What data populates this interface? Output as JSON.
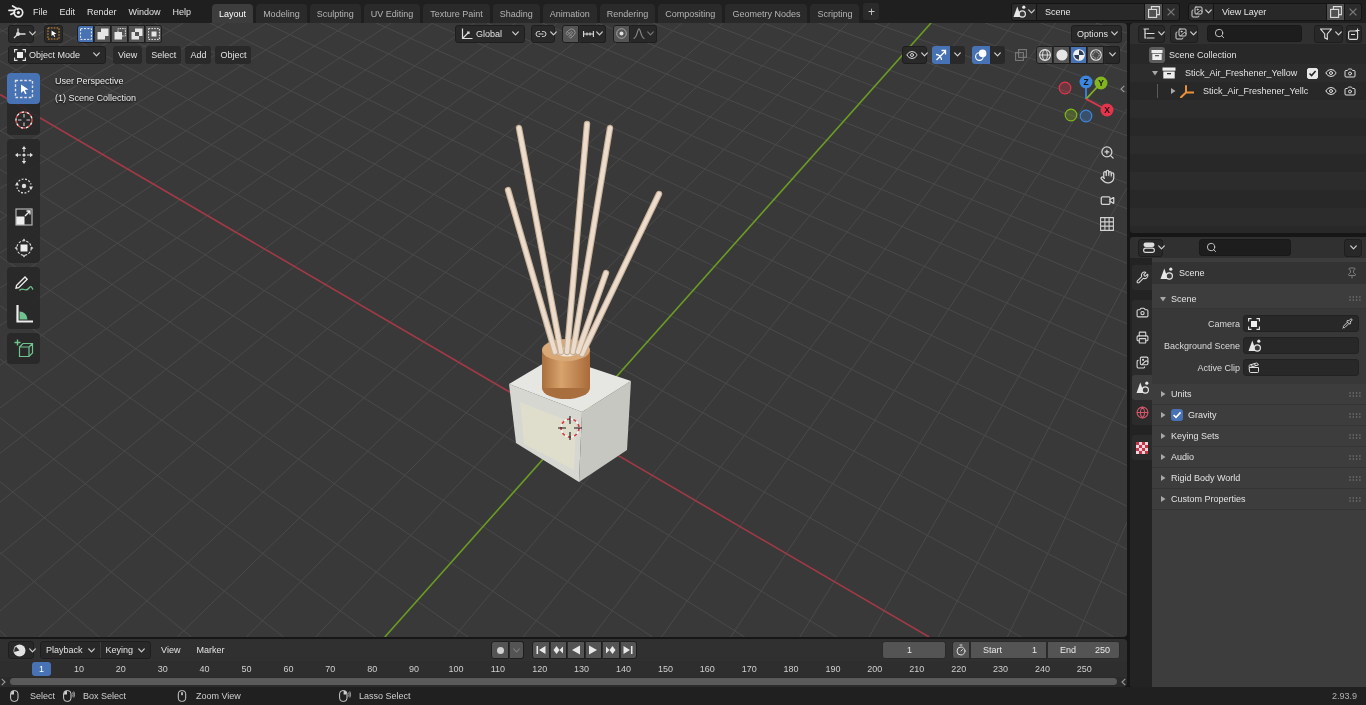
{
  "top_bar": {
    "menus": [
      "File",
      "Edit",
      "Render",
      "Window",
      "Help"
    ],
    "workspaces": [
      {
        "label": "Layout",
        "selected": true
      },
      {
        "label": "Modeling",
        "selected": false
      },
      {
        "label": "Sculpting",
        "selected": false
      },
      {
        "label": "UV Editing",
        "selected": false
      },
      {
        "label": "Texture Paint",
        "selected": false
      },
      {
        "label": "Shading",
        "selected": false
      },
      {
        "label": "Animation",
        "selected": false
      },
      {
        "label": "Rendering",
        "selected": false
      },
      {
        "label": "Compositing",
        "selected": false
      },
      {
        "label": "Geometry Nodes",
        "selected": false
      },
      {
        "label": "Scripting",
        "selected": false
      }
    ],
    "add_workspace": "+",
    "scene": "Scene",
    "view_layer": "View Layer"
  },
  "tool_settings": {
    "select_modes": [
      {
        "kind": "set",
        "selected": true
      },
      {
        "kind": "extend",
        "selected": false
      },
      {
        "kind": "subtract",
        "selected": false
      },
      {
        "kind": "difference",
        "selected": false
      },
      {
        "kind": "intersect",
        "selected": false
      }
    ],
    "orientation": "Global",
    "options": "Options"
  },
  "viewport_header": {
    "mode": "Object Mode",
    "menus": [
      "View",
      "Select",
      "Add",
      "Object"
    ],
    "toggles": [
      {
        "kind": "gizmos",
        "on": true
      },
      {
        "kind": "overlays",
        "on": true
      },
      {
        "kind": "xray",
        "on": false
      }
    ],
    "shading_modes": [
      {
        "kind": "wireframe",
        "selected": false
      },
      {
        "kind": "solid",
        "selected": false
      },
      {
        "kind": "material",
        "selected": true
      },
      {
        "kind": "rendered",
        "selected": false
      }
    ]
  },
  "toolbar": {
    "tool_groups": [
      [
        {
          "kind": "select_box",
          "selected": true
        },
        {
          "kind": "cursor",
          "selected": false
        }
      ],
      [
        {
          "kind": "move",
          "selected": false
        },
        {
          "kind": "rotate",
          "selected": false
        },
        {
          "kind": "scale",
          "selected": false
        },
        {
          "kind": "transform",
          "selected": false
        }
      ],
      [
        {
          "kind": "annotate",
          "selected": false
        },
        {
          "kind": "measure",
          "selected": false
        }
      ],
      [
        {
          "kind": "add_cube",
          "selected": false
        }
      ]
    ]
  },
  "viewport": {
    "view_name": "User Perspective",
    "collection": "(1) Scene Collection",
    "gizmo_axes": [
      {
        "label": "X",
        "color": "#e5354c"
      },
      {
        "label": "Y",
        "color": "#82b51f"
      },
      {
        "label": "Z",
        "color": "#3b86de"
      }
    ]
  },
  "timeline": {
    "menus": [
      {
        "label": "Playback",
        "kind": "dropdown"
      },
      {
        "label": "Keying",
        "kind": "dropdown"
      },
      {
        "label": "View",
        "kind": "menu"
      },
      {
        "label": "Marker",
        "kind": "menu"
      }
    ],
    "current_frame": "1",
    "start_label": "Start",
    "start": "1",
    "end_label": "End",
    "end": "250",
    "playhead": "1",
    "ruler": [
      "10",
      "20",
      "30",
      "40",
      "50",
      "60",
      "70",
      "80",
      "90",
      "100",
      "110",
      "120",
      "130",
      "140",
      "150",
      "160",
      "170",
      "180",
      "190",
      "200",
      "210",
      "220",
      "230",
      "240",
      "250"
    ]
  },
  "outliner": {
    "tree": [
      {
        "label": "Scene Collection",
        "kind": "scene_collection",
        "children": [
          {
            "label": "Stick_Air_Freshener_Yellow",
            "kind": "collection",
            "expanded": true,
            "checked": true,
            "children": [
              {
                "label": "Stick_Air_Freshener_Yellc",
                "kind": "object",
                "expanded": false
              }
            ]
          }
        ]
      }
    ]
  },
  "properties": {
    "tab_groups": [
      [
        {
          "kind": "tool",
          "selected": false
        }
      ],
      [
        {
          "kind": "render",
          "selected": false
        },
        {
          "kind": "output",
          "selected": false
        },
        {
          "kind": "view_layer",
          "selected": false
        },
        {
          "kind": "scene",
          "selected": true
        },
        {
          "kind": "world",
          "selected": false
        }
      ],
      [
        {
          "kind": "texture",
          "selected": false
        }
      ]
    ],
    "context": "Scene",
    "panels": [
      {
        "title": "Scene",
        "expanded": true,
        "fields": [
          {
            "label": "Camera",
            "kind": "camera"
          },
          {
            "label": "Background Scene",
            "kind": "scene"
          },
          {
            "label": "Active Clip",
            "kind": "clip"
          }
        ]
      },
      {
        "title": "Units",
        "expanded": false
      },
      {
        "title": "Gravity",
        "expanded": false,
        "checked": true
      },
      {
        "title": "Keying Sets",
        "expanded": false
      },
      {
        "title": "Audio",
        "expanded": false
      },
      {
        "title": "Rigid Body World",
        "expanded": false
      },
      {
        "title": "Custom Properties",
        "expanded": false
      }
    ]
  },
  "status_bar": {
    "hints": [
      {
        "label": "Select",
        "kind": "left_click"
      },
      {
        "label": "Box Select",
        "kind": "left_drag"
      },
      {
        "label": "Zoom View",
        "kind": "middle"
      },
      {
        "label": "Lasso Select",
        "kind": "right_drag"
      }
    ],
    "version": "2.93.9"
  }
}
